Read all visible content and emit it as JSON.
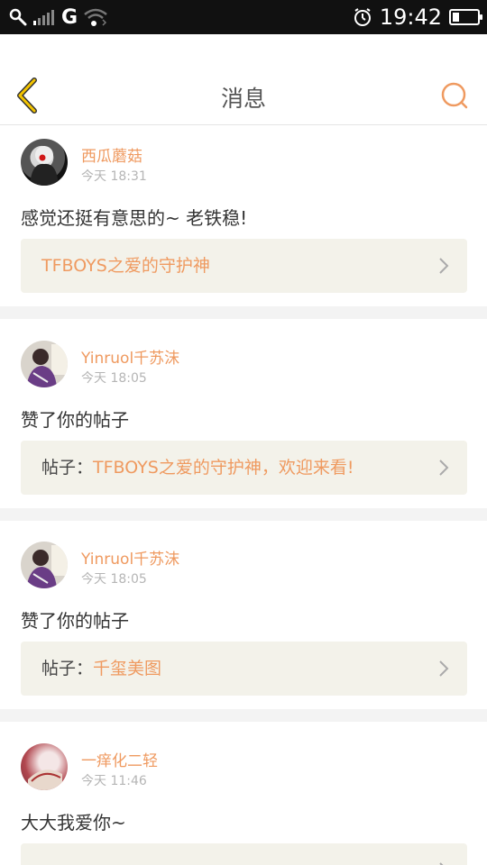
{
  "status_bar": {
    "network": "G",
    "time": "19:42",
    "battery_level": 0.25
  },
  "header": {
    "title": "消息",
    "back_icon": "chevron-left-icon",
    "search_icon": "search-icon"
  },
  "colors": {
    "accent": "#ef9a60",
    "back_yellow": "#f3c400",
    "card_bg": "#f3f2ea"
  },
  "messages": [
    {
      "username": "西瓜蘑菇",
      "time": "今天 18:31",
      "content": "感觉还挺有意思的~ 老铁稳!",
      "post_prefix": "",
      "post_title": "TFBOYS之爱的守护神"
    },
    {
      "username": "Yinruol千苏沫",
      "time": "今天 18:05",
      "content": "赞了你的帖子",
      "post_prefix": "帖子：",
      "post_title": "TFBOYS之爱的守护神，欢迎来看!"
    },
    {
      "username": "Yinruol千苏沫",
      "time": "今天 18:05",
      "content": "赞了你的帖子",
      "post_prefix": "帖子：",
      "post_title": "千玺美图"
    },
    {
      "username": "一痒化二轻",
      "time": "今天 11:46",
      "content": "大大我爱你~",
      "post_prefix": "",
      "post_title": ""
    }
  ]
}
